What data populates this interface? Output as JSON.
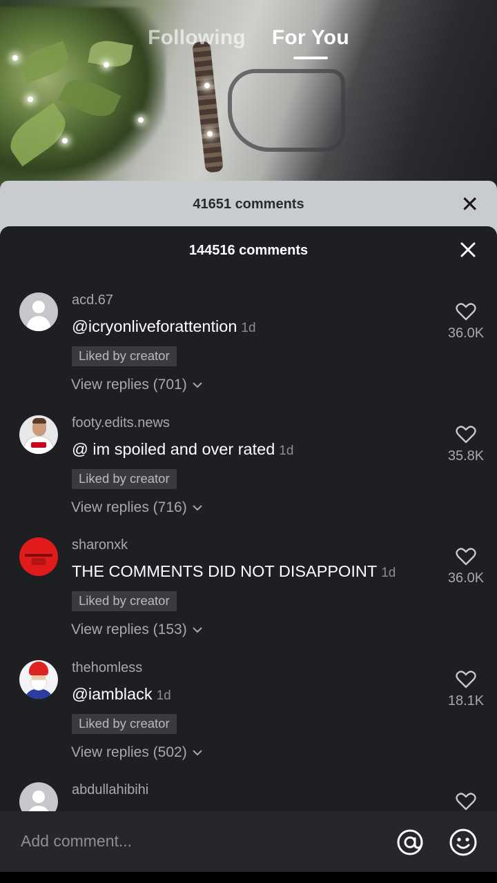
{
  "top_tabs": {
    "following": "Following",
    "for_you": "For You"
  },
  "ghost_sheet": {
    "count_label": "41651 comments"
  },
  "sheet": {
    "count_label": "144516 comments"
  },
  "comments": [
    {
      "username": "acd.67",
      "parts": [
        {
          "text": "@icryonliveforattention",
          "style": "mention"
        }
      ],
      "time": "1d",
      "liked_by_creator": "Liked by creator",
      "view_replies": "View replies (701)",
      "likes": "36.0K",
      "avatar": "default-avatar"
    },
    {
      "username": "footy.edits.news",
      "parts": [
        {
          "text": "@ im spoiled",
          "style": "mention"
        },
        {
          "text": " and over rated",
          "style": "plain"
        }
      ],
      "time": "1d",
      "liked_by_creator": "Liked by creator",
      "view_replies": "View replies (716)",
      "likes": "35.8K",
      "avatar": "football-player-avatar"
    },
    {
      "username": "sharonxk",
      "parts": [
        {
          "text": "THE COMMENTS DID NOT DISAPPOINT",
          "style": "plain"
        }
      ],
      "time": "1d",
      "liked_by_creator": "Liked by creator",
      "view_replies": "View replies (153)",
      "likes": "36.0K",
      "avatar": "red-avatar"
    },
    {
      "username": "thehomless",
      "parts": [
        {
          "text": "@iamblack",
          "style": "mention"
        }
      ],
      "time": "1d",
      "liked_by_creator": "Liked by creator",
      "view_replies": "View replies (502)",
      "likes": "18.1K",
      "avatar": "gnome-avatar"
    },
    {
      "username": "abdullahibihi",
      "parts": [],
      "time": "",
      "liked_by_creator": "",
      "view_replies": "",
      "likes": "",
      "avatar": "default-avatar"
    }
  ],
  "input": {
    "placeholder": "Add comment..."
  },
  "icons": {
    "close": "close-icon",
    "heart": "heart-icon",
    "chevron": "chevron-down-icon",
    "mention": "at-icon",
    "emoji": "emoji-icon"
  }
}
